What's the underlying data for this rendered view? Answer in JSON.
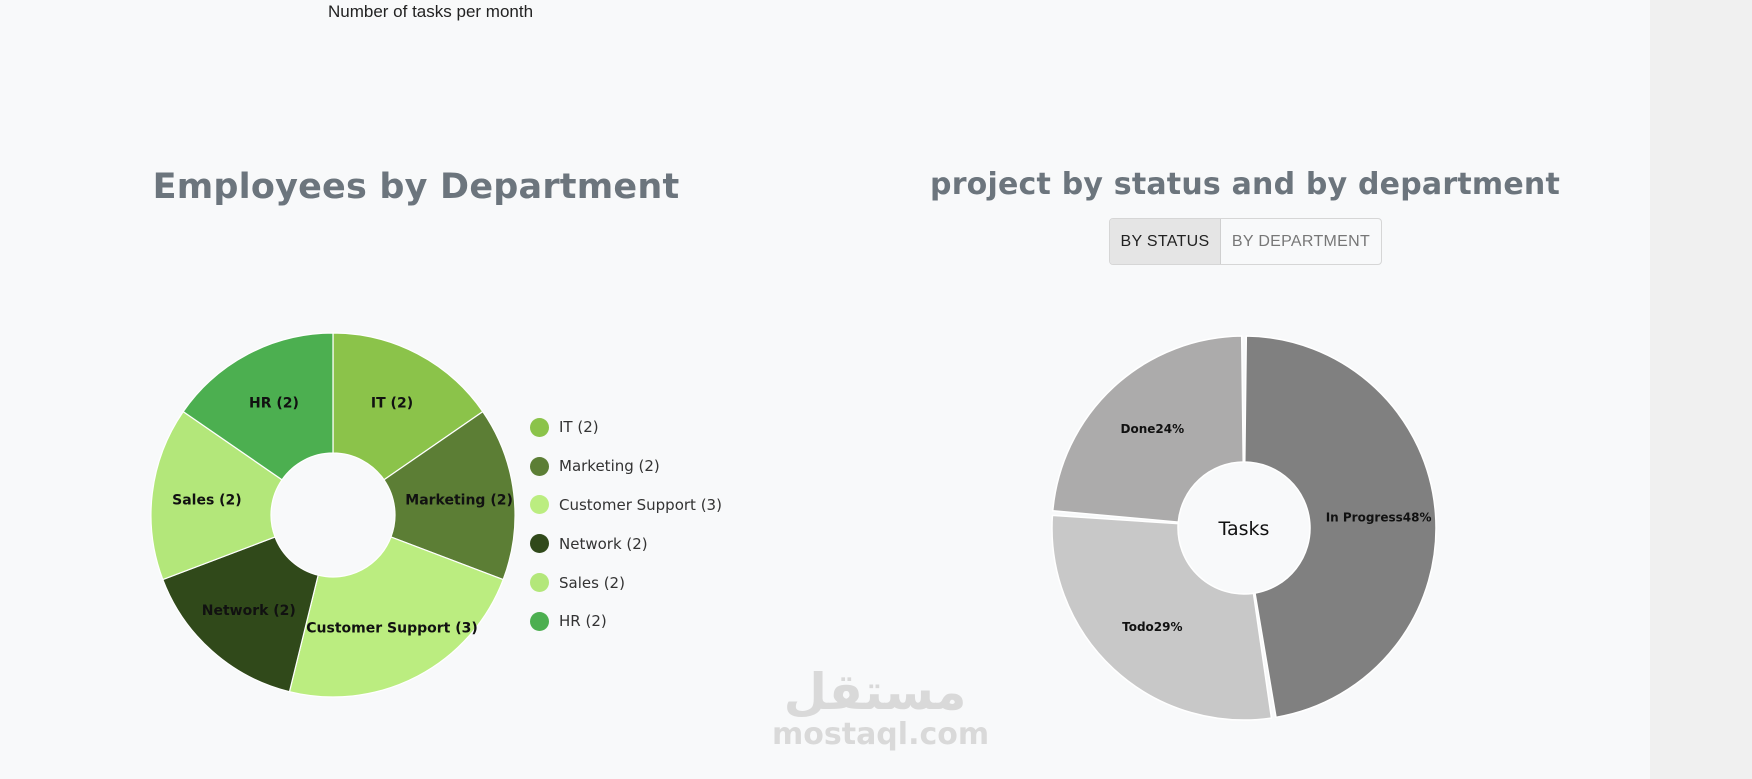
{
  "top_chart": {
    "title": "Number of tasks per month"
  },
  "employees_section": {
    "title": "Employees by Department"
  },
  "projects_section": {
    "title": "project by status and by department",
    "buttons": {
      "by_status": "BY STATUS",
      "by_department": "BY DEPARTMENT"
    },
    "active_button": "BY STATUS"
  },
  "watermark": {
    "arabic": "مستقل",
    "latin": "mostaql.com"
  },
  "chart_data": [
    {
      "type": "pie",
      "variant": "donut",
      "title": "Employees by Department",
      "legend": "right",
      "labels": [
        "IT (2)",
        "Marketing (2)",
        "Customer Support (3)",
        "Network (2)",
        "Sales (2)",
        "HR (2)"
      ],
      "values": [
        2,
        2,
        3,
        2,
        2,
        2
      ],
      "colors": [
        "#8bc34a",
        "#5c7e35",
        "#bbed80",
        "#30491a",
        "#b3e77a",
        "#4caf50"
      ]
    },
    {
      "type": "pie",
      "variant": "donut",
      "center_label": "Tasks",
      "labels": [
        "In Progress48%",
        "Todo29%",
        "Done24%"
      ],
      "values": [
        48,
        29,
        24
      ],
      "colors": [
        "#808080",
        "#c8c8c8",
        "#acabab"
      ]
    }
  ]
}
